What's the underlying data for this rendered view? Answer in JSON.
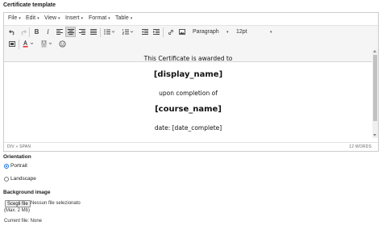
{
  "labels": {
    "certificate_template": "Certificate template",
    "orientation": "Orientation",
    "background_image": "Background image"
  },
  "menubar": [
    "File",
    "Edit",
    "View",
    "Insert",
    "Format",
    "Table"
  ],
  "toolbar": {
    "block_format": "Paragraph",
    "font_size": "12pt"
  },
  "content": {
    "line1": "This Certificate is awarded to",
    "line2": "[display_name]",
    "line3": "upon completion of",
    "line4": "[course_name]",
    "line5": "date: [date_complete]"
  },
  "statusbar": {
    "path": "DIV » SPAN",
    "word_count": "12 WORDS"
  },
  "orientation": {
    "options": [
      "Portrait",
      "Landscape"
    ],
    "selected": "Portrait"
  },
  "file_input": {
    "button": "Scegli file",
    "status": "Nessun file selezionato"
  },
  "max_size": "(Max. 2 Mb)",
  "current_file": "Current file: None",
  "colors": {
    "border": "#cccccc",
    "toolbar_bg": "#f5f5f5",
    "radio_accent": "#1a73e8"
  }
}
